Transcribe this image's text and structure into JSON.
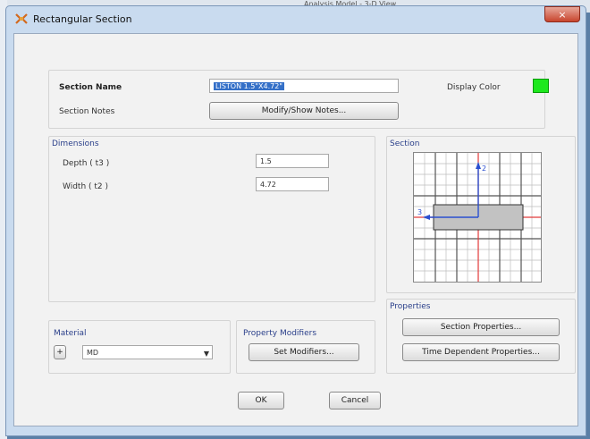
{
  "window": {
    "title": "Rectangular Section",
    "close_glyph": "×"
  },
  "background_window": {
    "title_fragment": "Analysis Model - 3-D View"
  },
  "section": {
    "name_label": "Section Name",
    "name_value": "LISTON 1.5\"X4.72\"",
    "notes_label": "Section Notes",
    "notes_button": "Modify/Show Notes...",
    "display_color_label": "Display Color",
    "display_color": "#1ee81e"
  },
  "dimensions": {
    "title": "Dimensions",
    "depth_label": "Depth  ( t3 )",
    "depth_value": "1.5",
    "width_label": "Width  ( t2 )",
    "width_value": "4.72"
  },
  "preview": {
    "title": "Section",
    "axis2_label": "2",
    "axis3_label": "3"
  },
  "properties": {
    "title": "Properties",
    "section_properties_button": "Section Properties...",
    "time_dependent_button": "Time Dependent Properties..."
  },
  "material": {
    "title": "Material",
    "add_button": "+",
    "selected": "MD"
  },
  "property_modifiers": {
    "title": "Property Modifiers",
    "button": "Set Modifiers..."
  },
  "footer": {
    "ok": "OK",
    "cancel": "Cancel"
  },
  "icons": {
    "app": "etabs-section-icon",
    "close": "close-icon",
    "dropdown": "chevron-down-icon"
  }
}
